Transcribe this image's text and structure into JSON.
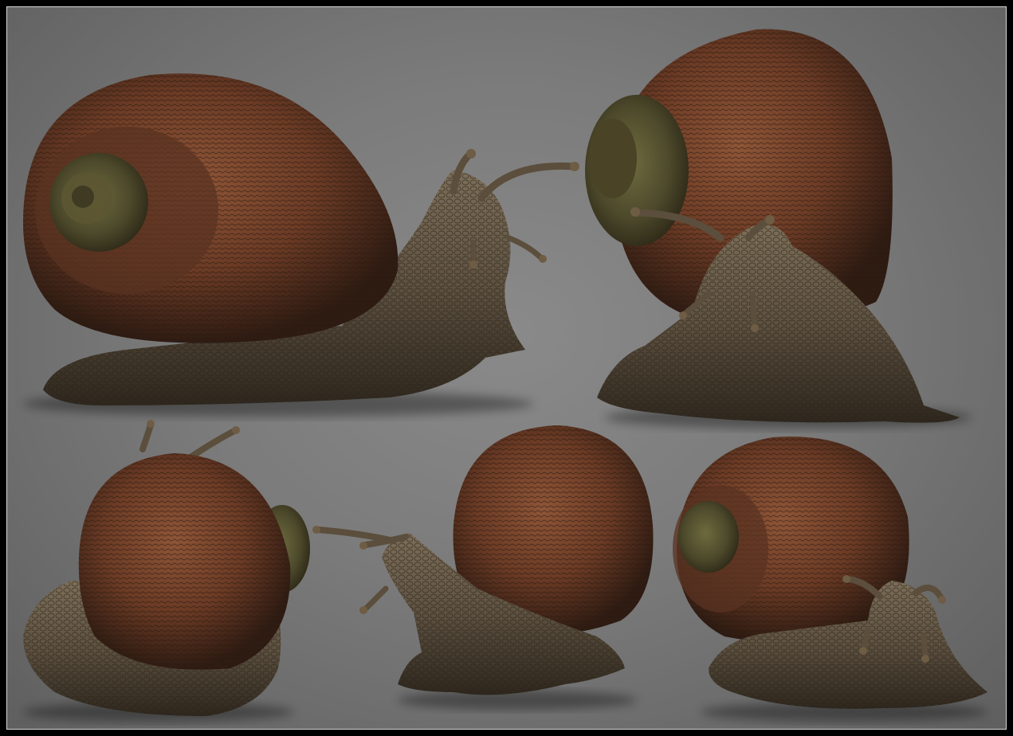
{
  "colors": {
    "background_light": "#8a8a8a",
    "background_dark": "#5f5f5f",
    "frame": "#000000",
    "frame_line": "#d8d8d8",
    "shell_dark": "#3b2418",
    "shell_mid": "#6b3b25",
    "shell_light": "#8e5537",
    "shell_green": "#4d4a2c",
    "body_dark": "#3a3226",
    "body_mid": "#5d5140",
    "body_light": "#7c6e58"
  },
  "views": [
    {
      "name": "side-view"
    },
    {
      "name": "front-three-quarter-view"
    },
    {
      "name": "rear-view"
    },
    {
      "name": "left-side-view"
    },
    {
      "name": "front-view"
    }
  ]
}
